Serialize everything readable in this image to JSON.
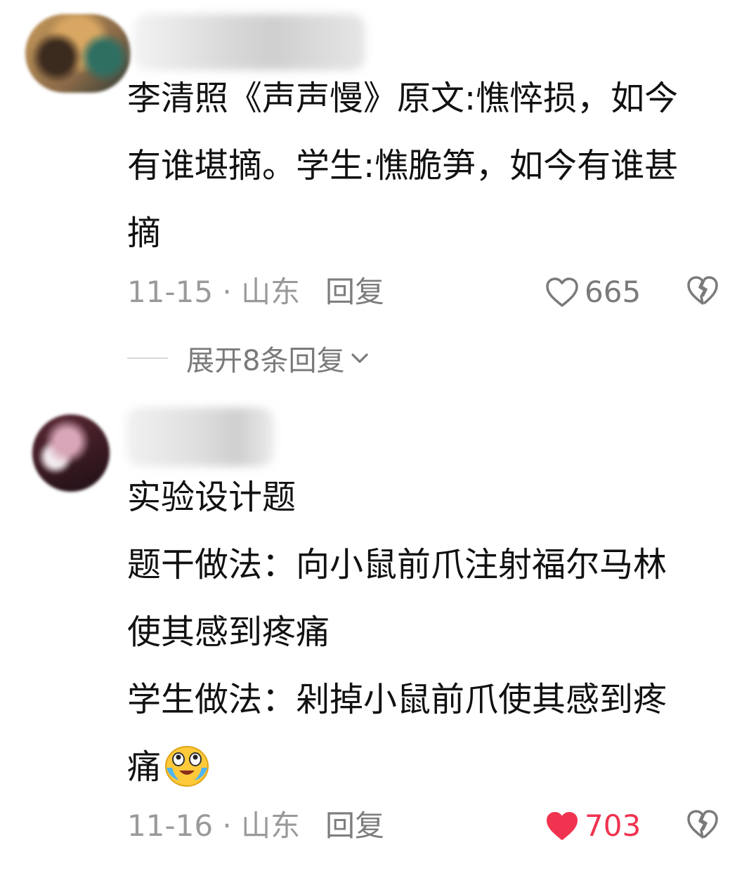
{
  "comments": [
    {
      "text_lines": [
        "李清照《声声慢》原文:憔悴损，如今",
        "有谁堪摘。学生:憔脆笋，如今有谁甚",
        "摘"
      ],
      "date_location": "11-15 · 山东",
      "reply_label": "回复",
      "like_count": "665",
      "liked": false,
      "expand_label": "展开8条回复"
    },
    {
      "text_lines": [
        "实验设计题",
        "题干做法：向小鼠前爪注射福尔马林",
        "使其感到疼痛",
        "学生做法：剁掉小鼠前爪使其感到疼",
        "痛"
      ],
      "emoji": "crying-laughing-emoji",
      "date_location": "11-16 · 山东",
      "reply_label": "回复",
      "like_count": "703",
      "liked": true
    }
  ],
  "colors": {
    "text": "#111111",
    "meta": "#9a9a9a",
    "liked": "#f0334f",
    "icon_gray": "#7a7a7a"
  },
  "icons": {
    "like": "heart-outline-icon",
    "liked": "heart-filled-icon",
    "dislike": "broken-heart-icon",
    "expand": "chevron-down-icon"
  }
}
